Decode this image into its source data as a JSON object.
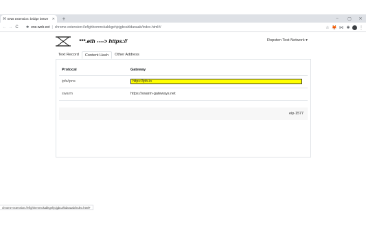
{
  "browser": {
    "tab_title": "ENS extension: bridge betwe",
    "tab_favicon": "⌘",
    "new_tab": "+",
    "window_controls": [
      "–",
      "▢",
      "✕"
    ],
    "nav": {
      "back": "←",
      "forward": "→",
      "reload": "C"
    },
    "address": {
      "origin": "ens-web-ext",
      "separator": "|",
      "url": "chrome-extension://efighhemmckabkgehjojgbcahldanaab/index.html#/"
    },
    "toolbar_icons": [
      "☆",
      "🦊",
      "⋈",
      "✱",
      "⋮"
    ]
  },
  "app": {
    "title": "***.eth ----> https://",
    "network": "Ropsten Test Network ▾",
    "tabs": [
      "Text Record",
      "Content Hash",
      "Other Address"
    ],
    "active_tab": "Content Hash",
    "table": {
      "headers": {
        "protocol": "Protocal",
        "gateway": "Gateway"
      },
      "rows": [
        {
          "protocol": "ipfs/ipns",
          "gateway": "https://ipfs.io"
        },
        {
          "protocol": "swarm",
          "gateway": "https://swarm-gateways.net"
        }
      ]
    },
    "footer": "eip-1577"
  },
  "status_bar": "chrome-extension://efighhemmckabkgehjojgbcahldanaab/index.html#"
}
